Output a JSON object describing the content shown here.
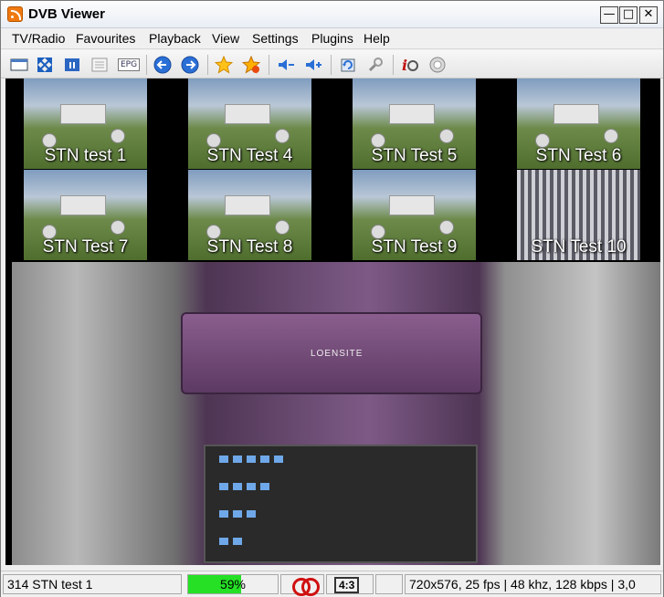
{
  "window": {
    "title": "DVB Viewer"
  },
  "menu": [
    "TV/Radio",
    "Favourites",
    "Playback",
    "View",
    "Settings",
    "Plugins",
    "Help"
  ],
  "toolbar": {
    "epg_label": "EPG"
  },
  "thumbnails": [
    {
      "label": "STN test 1"
    },
    {
      "label": "STN Test 4"
    },
    {
      "label": "STN Test 5"
    },
    {
      "label": "STN Test 6"
    },
    {
      "label": "STN Test 7"
    },
    {
      "label": "STN Test 8"
    },
    {
      "label": "STN Test 9"
    },
    {
      "label": "STN Test 10"
    }
  ],
  "main_video": {
    "brand": "LOENSITE"
  },
  "status": {
    "channel": "314 STN test 1",
    "signal_percent": 59,
    "signal_label": "59%",
    "aspect": "4:3",
    "stream_info": "720x576, 25 fps | 48 khz, 128 kbps | 3,0"
  }
}
